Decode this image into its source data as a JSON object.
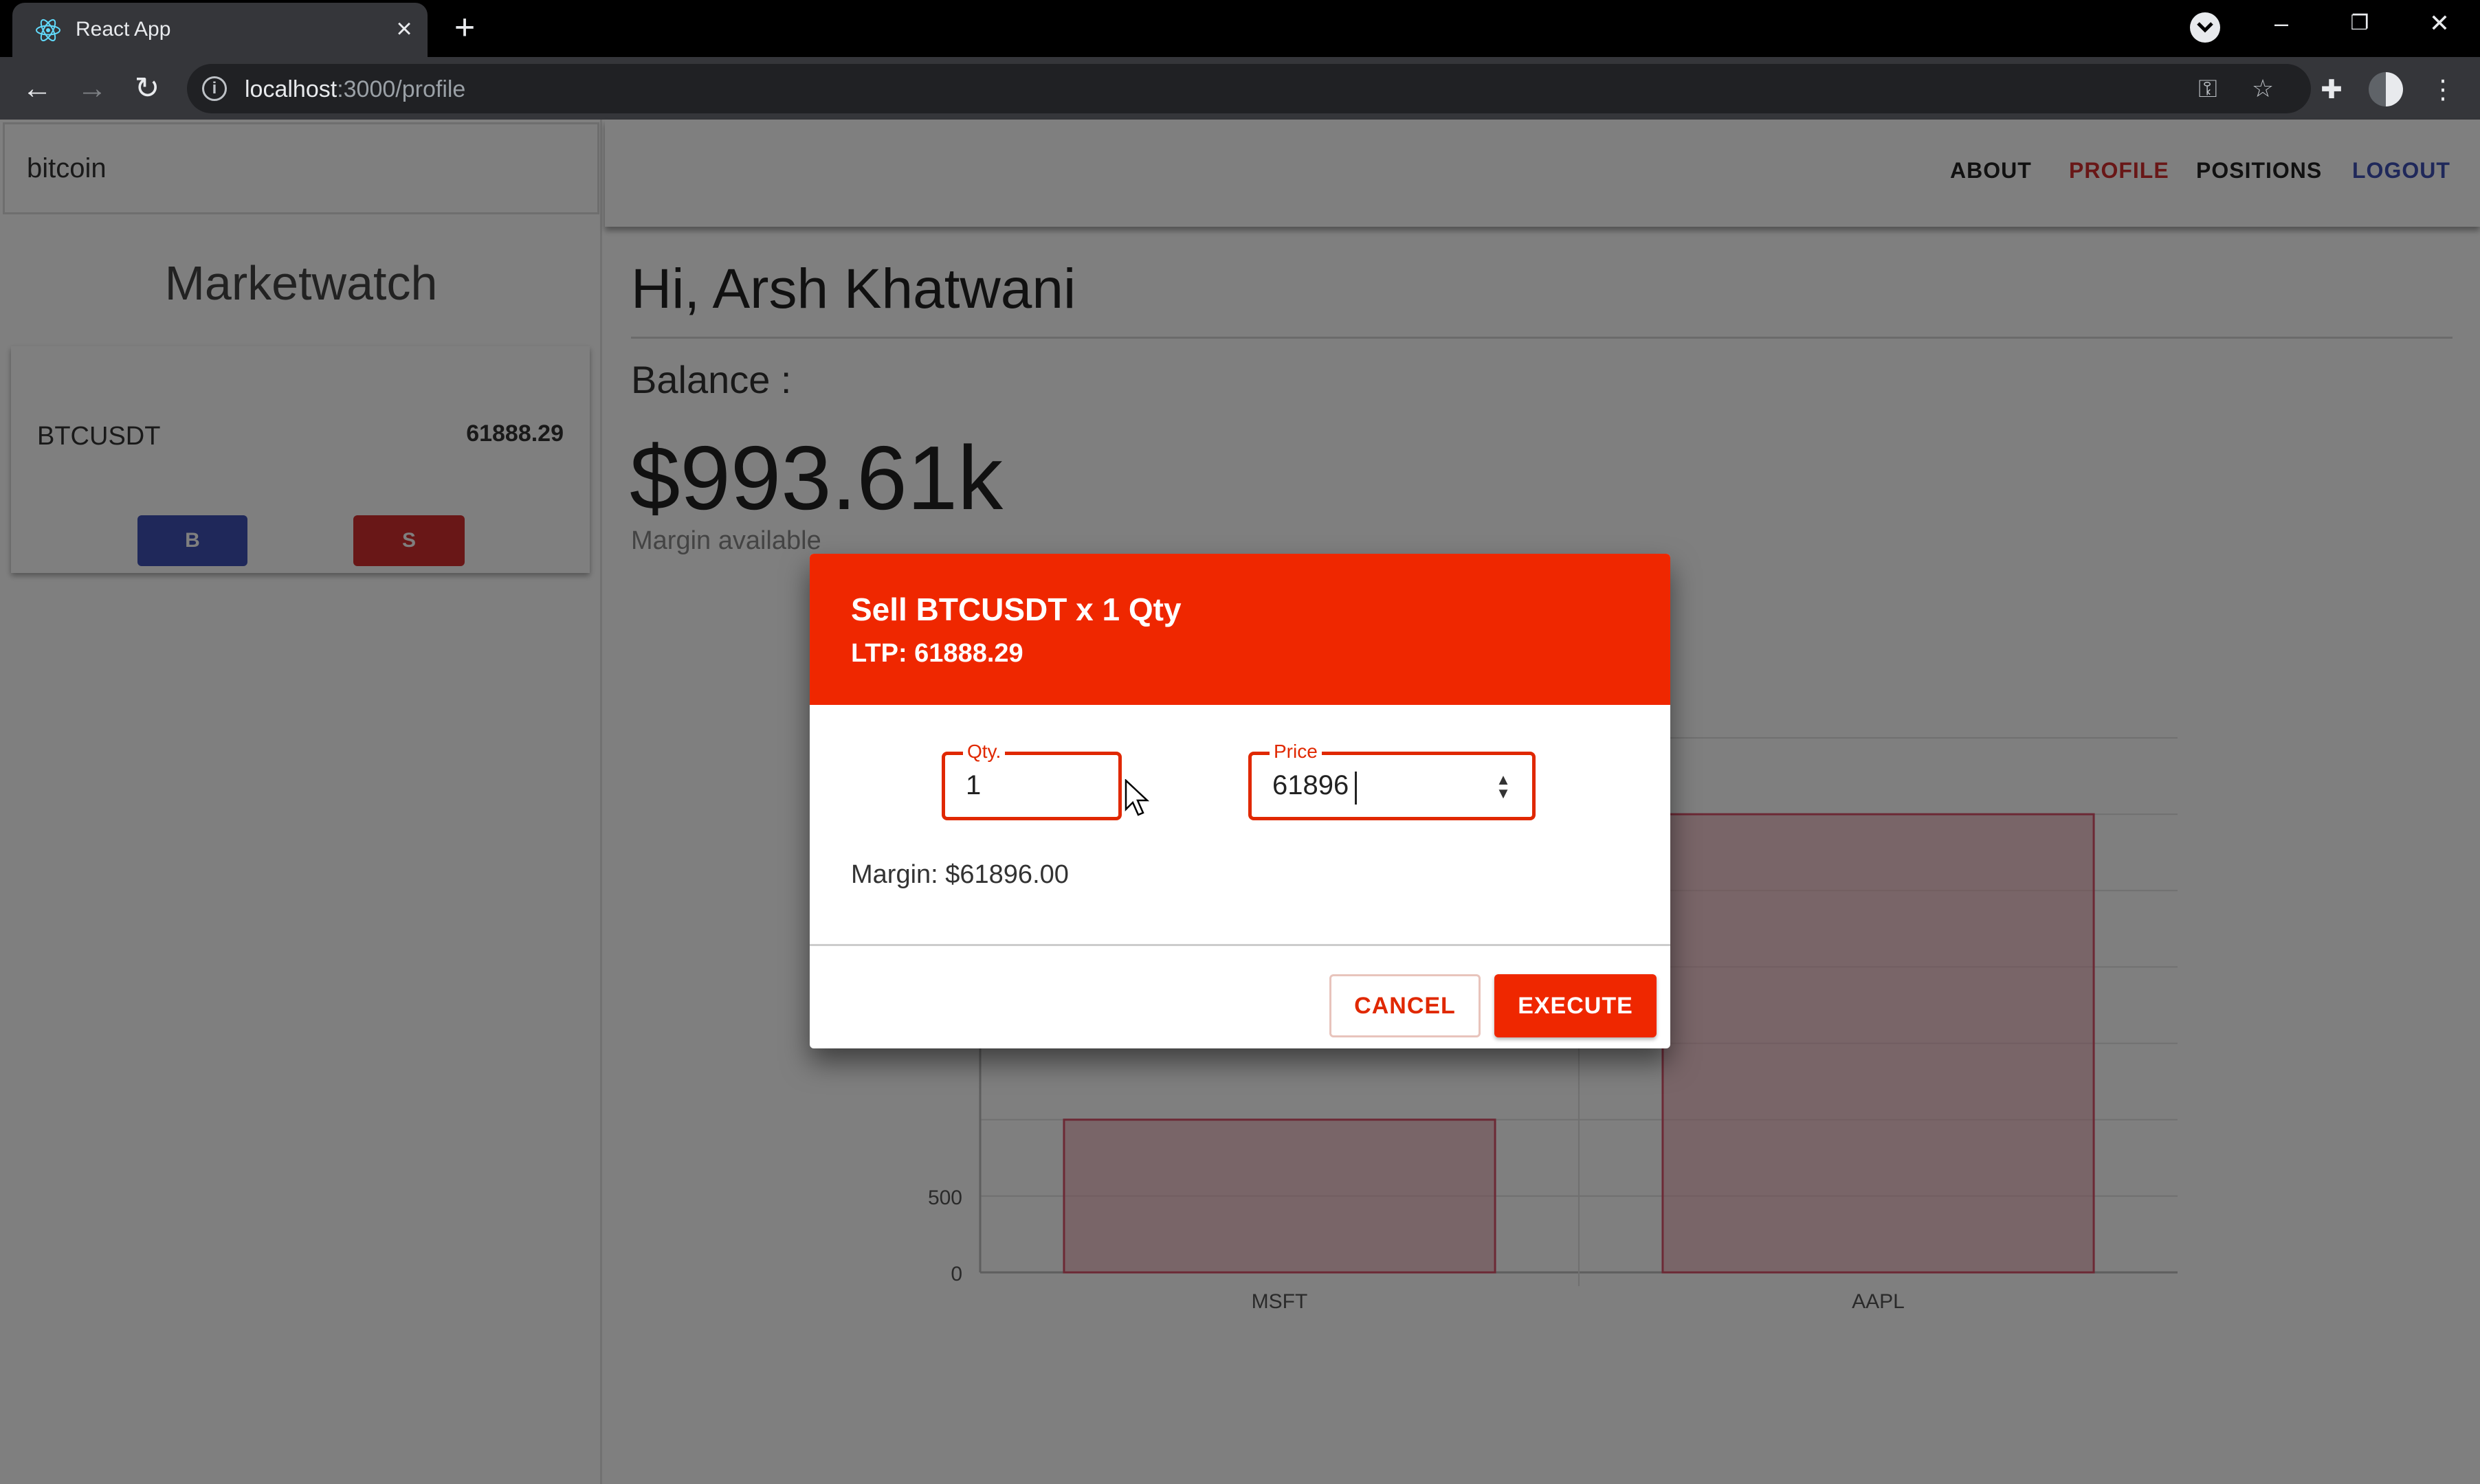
{
  "browser": {
    "tab_title": "React App",
    "url_host": "localhost",
    "url_path": ":3000/profile"
  },
  "sidebar": {
    "search_value": "bitcoin",
    "title": "Marketwatch",
    "items": [
      {
        "symbol": "BTCUSDT",
        "ltp": "61888.29",
        "buy_label": "B",
        "sell_label": "S"
      }
    ]
  },
  "nav": {
    "links": [
      {
        "label": "ABOUT",
        "color": "#222222"
      },
      {
        "label": "PROFILE",
        "color": "#d32f2f"
      },
      {
        "label": "POSITIONS",
        "color": "#222222"
      },
      {
        "label": "LOGOUT",
        "color": "#3f51b5"
      }
    ]
  },
  "profile": {
    "greeting": "Hi, Arsh Khatwani",
    "balance_label": "Balance :",
    "balance_value": "$993.61k",
    "margin_label": "Margin available"
  },
  "chart_data": {
    "type": "bar",
    "categories": [
      "MSFT",
      "AAPL"
    ],
    "values": [
      1000,
      3000
    ],
    "ylim": [
      0,
      3500
    ],
    "yticks": [
      "0",
      "500"
    ],
    "bar_color": "#e8a0aa"
  },
  "dialog": {
    "title": "Sell BTCUSDT x 1 Qty",
    "ltp": "LTP: 61888.29",
    "qty_label": "Qty.",
    "qty_value": "1",
    "price_label": "Price",
    "price_value": "61896",
    "margin": "Margin: $61896.00",
    "cancel_label": "CANCEL",
    "execute_label": "EXECUTE",
    "accent_color": "#ef2700"
  }
}
